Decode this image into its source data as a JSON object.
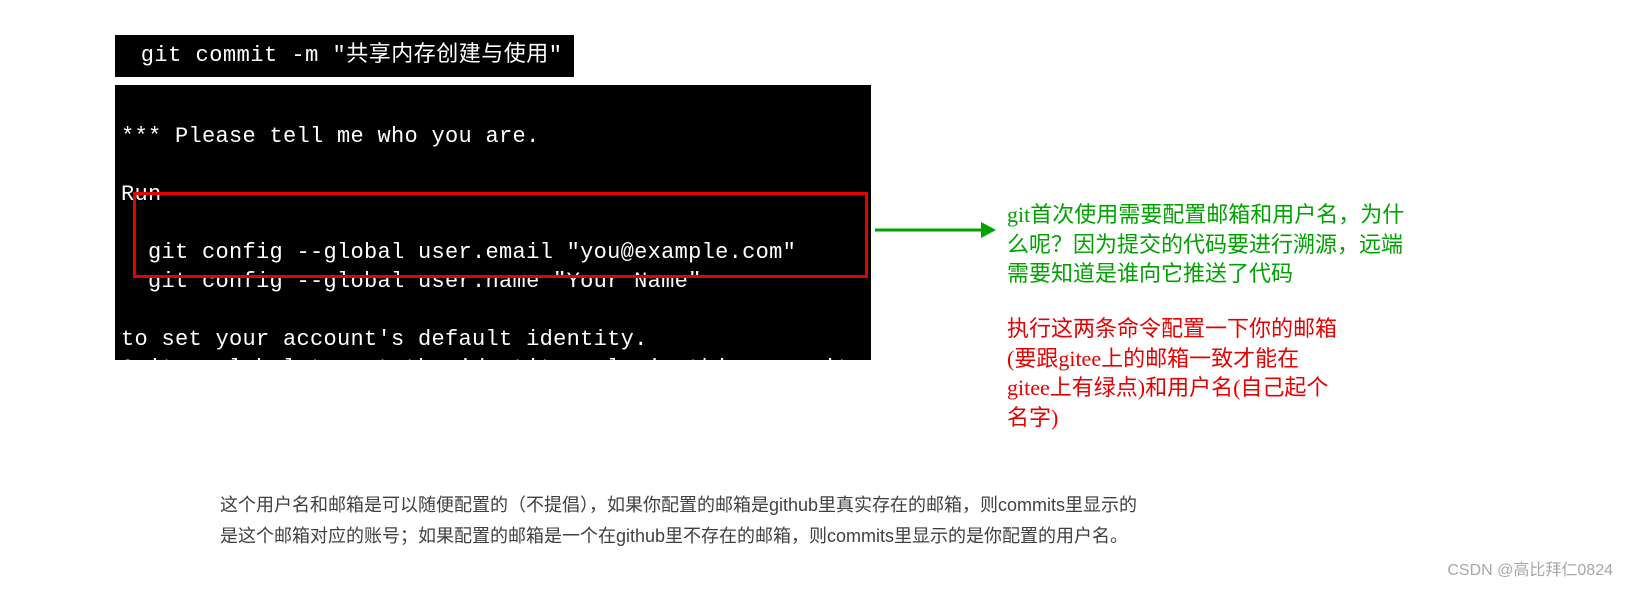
{
  "cmd": " git commit -m \"共享内存创建与使用\"",
  "terminal": {
    "l1": "*** Please tell me who you are.",
    "l2": "",
    "l3": "Run",
    "l4": "",
    "l5": "  git config --global user.email \"you@example.com\"",
    "l6": "  git config --global user.name \"Your Name\"",
    "l7": "",
    "l8": "to set your account's default identity.",
    "l9": "Omit --global to set the identity only in this repository."
  },
  "annotations": {
    "green": "git首次使用需要配置邮箱和用户名，为什么呢？因为提交的代码要进行溯源，远端需要知道是谁向它推送了代码",
    "red": "执行这两条命令配置一下你的邮箱(要跟gitee上的邮箱一致才能在gitee上有绿点)和用户名(自己起个名字)"
  },
  "body_text": "这个用户名和邮箱是可以随便配置的（不提倡），如果你配置的邮箱是github里真实存在的邮箱，则commits里显示的是这个邮箱对应的账号；如果配置的邮箱是一个在github里不存在的邮箱，则commits里显示的是你配置的用户名。",
  "watermark": "CSDN @高比拜仁0824",
  "colors": {
    "green": "#00a200",
    "red": "#e60000",
    "terminal_bg": "#000000",
    "terminal_fg": "#ffffff"
  }
}
